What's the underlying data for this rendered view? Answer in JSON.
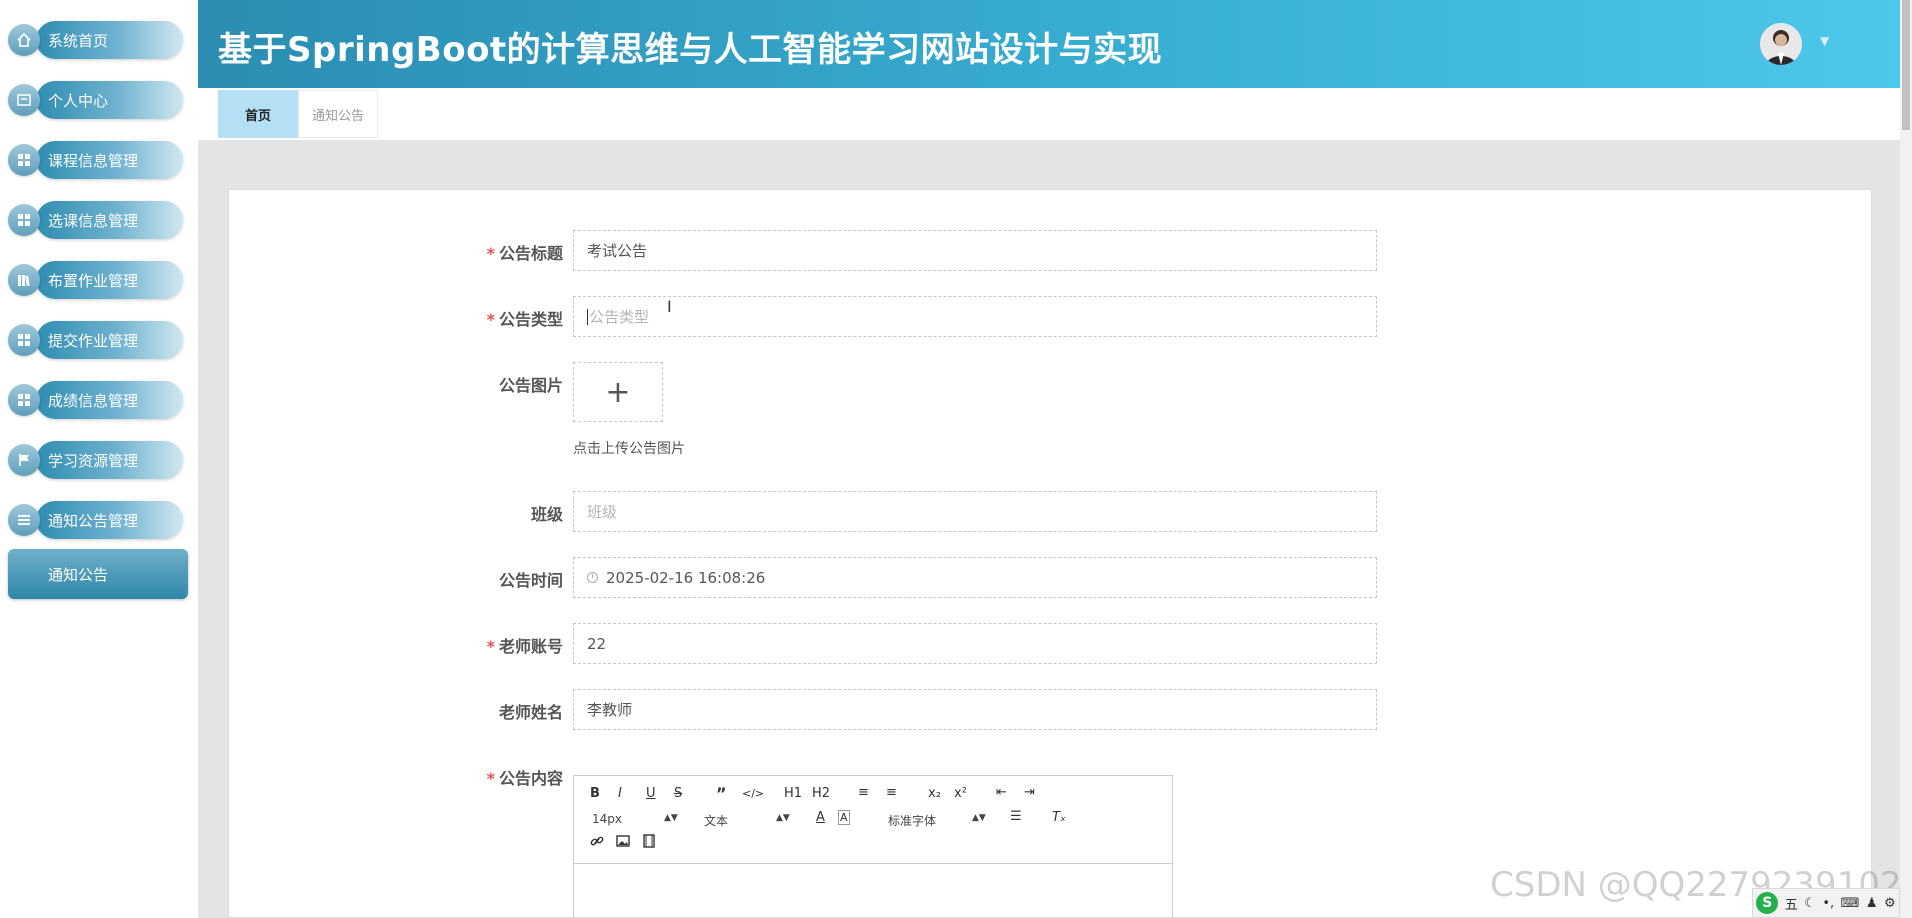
{
  "header": {
    "title": "基于SpringBoot的计算思维与人工智能学习网站设计与实现",
    "avatar": "avatar-icon"
  },
  "sidebar": {
    "items": [
      {
        "label": "系统首页",
        "icon": "home-icon"
      },
      {
        "label": "个人中心",
        "icon": "user-card-icon"
      },
      {
        "label": "课程信息管理",
        "icon": "grid-icon"
      },
      {
        "label": "选课信息管理",
        "icon": "grid-icon"
      },
      {
        "label": "布置作业管理",
        "icon": "books-icon"
      },
      {
        "label": "提交作业管理",
        "icon": "grid-icon"
      },
      {
        "label": "成绩信息管理",
        "icon": "grid-icon"
      },
      {
        "label": "学习资源管理",
        "icon": "flag-icon"
      },
      {
        "label": "通知公告管理",
        "icon": "list-icon"
      }
    ],
    "active_subitem": "通知公告"
  },
  "tabs": [
    {
      "label": "首页",
      "active": true
    },
    {
      "label": "通知公告",
      "active": false
    }
  ],
  "form": {
    "title_label": "公告标题",
    "title_value": "考试公告",
    "type_label": "公告类型",
    "type_placeholder": "公告类型",
    "image_label": "公告图片",
    "image_upload_hint": "点击上传公告图片",
    "class_label": "班级",
    "class_placeholder": "班级",
    "time_label": "公告时间",
    "time_value": "2025-02-16 16:08:26",
    "teacher_account_label": "老师账号",
    "teacher_account_value": "22",
    "teacher_name_label": "老师姓名",
    "teacher_name_value": "李教师",
    "content_label": "公告内容",
    "required_mark": "*"
  },
  "editor": {
    "toolbar_row1": [
      "B",
      "I",
      "U",
      "S",
      "”",
      "</>",
      "H1",
      "H2",
      "≡",
      "≡",
      "x₂",
      "x²",
      "⇤",
      "⇥"
    ],
    "font_size": "14px",
    "text_format": "文本",
    "font_family": "标准字体"
  },
  "watermark": "CSDN @QQ2279239102",
  "tray": {
    "ime": "五",
    "logo": "S"
  },
  "colors": {
    "header_start": "#2b8db2",
    "header_end": "#4dc7ea",
    "active_tab": "#b3e0f5",
    "required": "#e55353"
  }
}
